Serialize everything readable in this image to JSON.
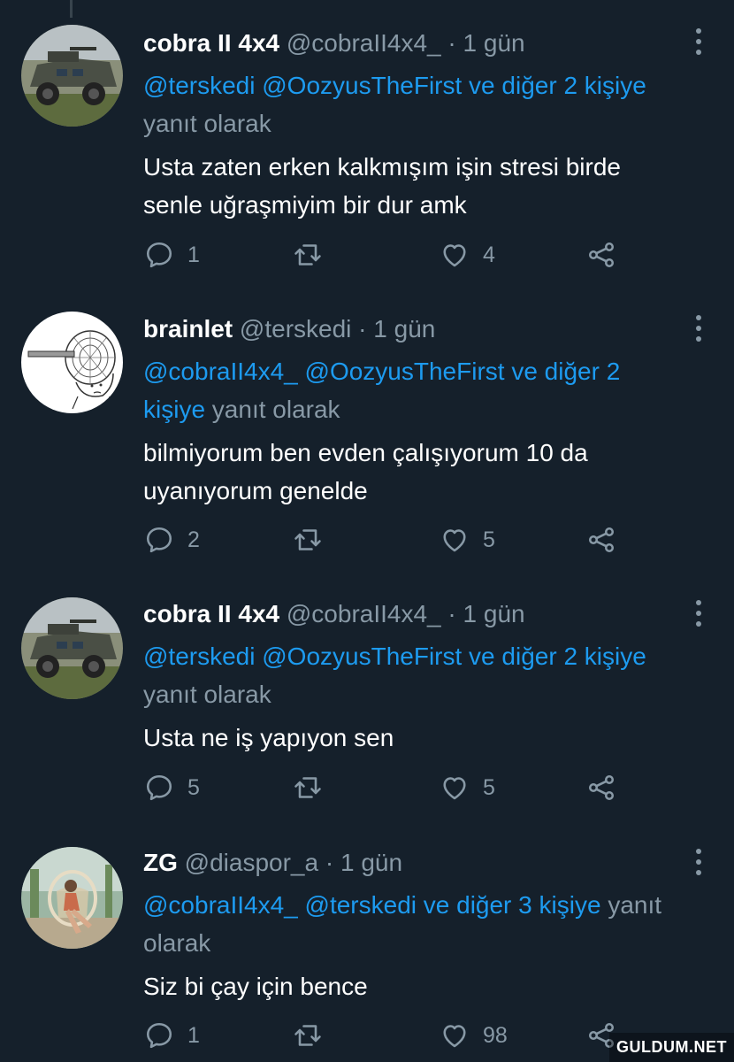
{
  "tweets": [
    {
      "name": "cobra II 4x4",
      "handle": "@cobraII4x4_",
      "time": "1 gün",
      "reply_mentions": "@terskedi @OozyusTheFirst ve diğer 2 kişiye",
      "reply_suffix": "yanıt olarak",
      "text_lines": [
        "Usta zaten erken kalkmışım işin stresi birde",
        "senle uğraşmiyim bir dur amk"
      ],
      "replies": "1",
      "retweets": "",
      "likes": "4",
      "avatar": "armored-vehicle-avatar"
    },
    {
      "name": "brainlet",
      "handle": "@terskedi",
      "time": "1 gün",
      "reply_mentions_1": "@cobraII4x4_ @OozyusTheFirst ve diğer 2",
      "reply_mentions_2": "kişiye",
      "reply_suffix": "yanıt olarak",
      "text_lines": [
        "bilmiyorum ben evden çalışıyorum 10 da",
        "uyanıyorum genelde"
      ],
      "replies": "2",
      "retweets": "",
      "likes": "5",
      "avatar": "brainlet-meme-avatar"
    },
    {
      "name": "cobra II 4x4",
      "handle": "@cobraII4x4_",
      "time": "1 gün",
      "reply_mentions": "@terskedi @OozyusTheFirst ve diğer 2 kişiye",
      "reply_suffix": "yanıt olarak",
      "text_lines": [
        "Usta ne iş yapıyon sen"
      ],
      "replies": "5",
      "retweets": "",
      "likes": "5",
      "avatar": "armored-vehicle-avatar"
    },
    {
      "name": "ZG",
      "handle": "@diaspor_a",
      "time": "1 gün",
      "reply_mentions": "@cobraII4x4_ @terskedi ve diğer 3 kişiye",
      "reply_suffix_1": "yanıt",
      "reply_suffix_2": "olarak",
      "text_lines": [
        "Siz bi çay için bence"
      ],
      "replies": "1",
      "retweets": "",
      "likes": "98",
      "avatar": "woman-on-swing-avatar"
    }
  ],
  "separator": "·",
  "watermark": "GULDUM.NET",
  "colors": {
    "background": "#15202b",
    "mention": "#1d9bf0",
    "muted": "#8899a6",
    "text": "#ffffff"
  },
  "icons": [
    "reply-icon",
    "retweet-icon",
    "like-icon",
    "share-icon",
    "more-options-icon"
  ]
}
